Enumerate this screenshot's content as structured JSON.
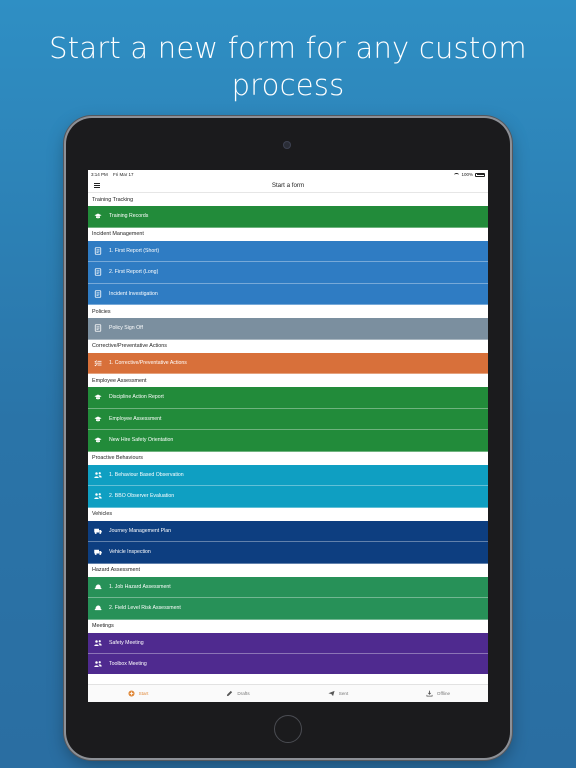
{
  "headline": "Start a new form for any custom process",
  "status": {
    "time": "3:14 PM",
    "date": "Fri Mar 17",
    "battery": "100%"
  },
  "navbar": {
    "title": "Start a form"
  },
  "sections": [
    {
      "title": "Training Tracking",
      "color": "#228b3a",
      "icon": "graduation-cap-icon",
      "items": [
        "Training Records"
      ]
    },
    {
      "title": "Incident Management",
      "color": "#2f7cc3",
      "icon": "form-document-icon",
      "items": [
        "1. First Report (Short)",
        "2. First Report (Long)",
        "Incident Investigation"
      ]
    },
    {
      "title": "Policies",
      "color": "#7b8f9f",
      "icon": "form-document-icon",
      "items": [
        "Policy Sign Off"
      ]
    },
    {
      "title": "Corrective/Preventative Actions",
      "color": "#d8703a",
      "icon": "checklist-icon",
      "items": [
        "1. Corrective/Preventative Actions"
      ]
    },
    {
      "title": "Employee Assessment",
      "color": "#228b3a",
      "icon": "graduation-cap-icon",
      "items": [
        "Discipline Action Report",
        "Employee Assessment",
        "New Hire Safety Orientation"
      ]
    },
    {
      "title": "Proactive Behaviours",
      "color": "#0f9fc2",
      "icon": "people-icon",
      "items": [
        "1. Behaviour Based Observation",
        "2. BBO Observer Evaluation"
      ]
    },
    {
      "title": "Vehicles",
      "color": "#0d3e80",
      "icon": "truck-icon",
      "items": [
        "Journey Management Plan",
        "Vehicle Inspection"
      ]
    },
    {
      "title": "Hazard Assessment",
      "color": "#279158",
      "icon": "hard-hat-icon",
      "items": [
        "1. Job Hazard Assessment",
        "2. Field Level Risk Assessment"
      ]
    },
    {
      "title": "Meetings",
      "color": "#4f2a8f",
      "icon": "people-icon",
      "items": [
        "Safety Meeting",
        "Toolbox Meeting"
      ]
    }
  ],
  "tabs": [
    {
      "label": "Start",
      "icon": "plus-circle-icon",
      "active": true
    },
    {
      "label": "Drafts",
      "icon": "pencil-icon",
      "active": false
    },
    {
      "label": "Sent",
      "icon": "paper-plane-icon",
      "active": false
    },
    {
      "label": "Offline",
      "icon": "download-icon",
      "active": false
    }
  ],
  "colors": {
    "active_tab": "#e0893a"
  }
}
